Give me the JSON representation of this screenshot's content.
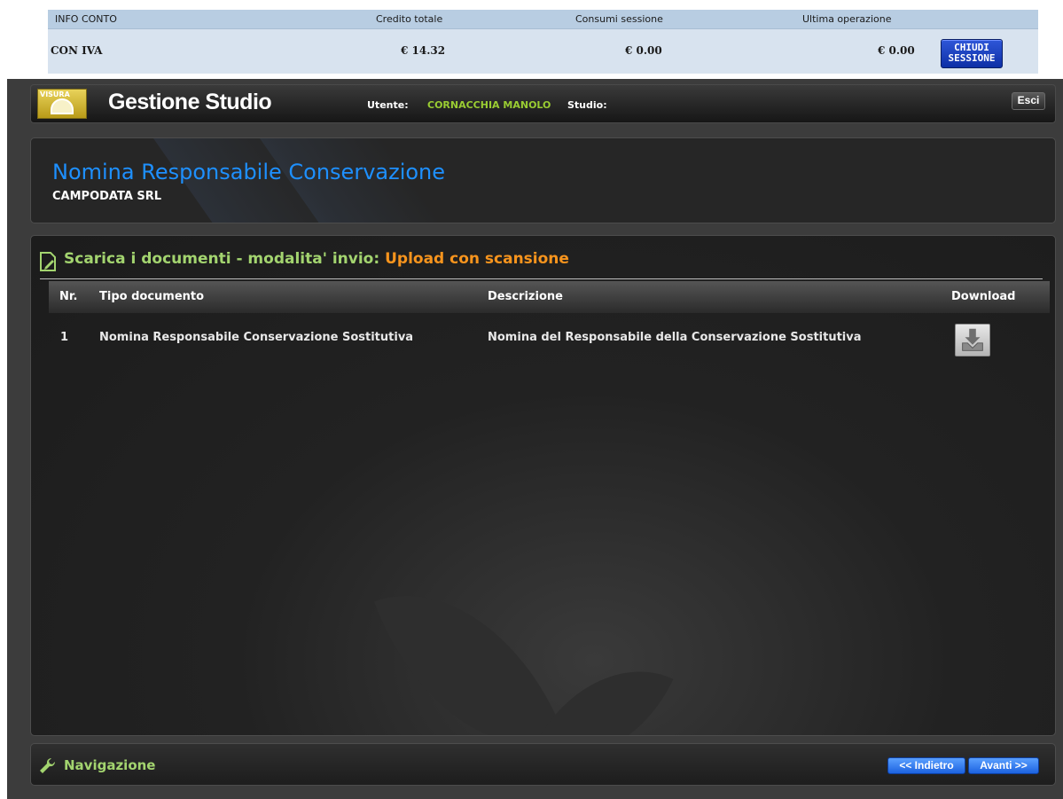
{
  "account": {
    "head": {
      "info": "INFO CONTO",
      "credit": "Credito totale",
      "session": "Consumi sessione",
      "last": "Ultima operazione"
    },
    "row": {
      "label": "CON IVA",
      "credit": "€ 14.32",
      "session": "€ 0.00",
      "last": "€ 0.00"
    },
    "close_button": {
      "line1": "CHIUDI",
      "line2": "SESSIONE"
    }
  },
  "header": {
    "logo_text": "VISURA",
    "app_title": "Gestione Studio",
    "user_label": "Utente:",
    "user_name": "CORNACCHIA MANOLO",
    "studio_label": "Studio:",
    "studio_value": "",
    "exit_label": "Esci"
  },
  "title_panel": {
    "title": "Nomina Responsabile Conservazione",
    "subtitle": "CAMPODATA SRL"
  },
  "documents": {
    "heading": "Scarica i documenti - modalita' invio:",
    "mode": "Upload con scansione",
    "columns": [
      "Nr.",
      "Tipo documento",
      "Descrizione",
      "Download"
    ],
    "rows": [
      {
        "nr": "1",
        "type": "Nomina Responsabile Conservazione Sostitutiva",
        "description": "Nomina del Responsabile della Conservazione Sostitutiva",
        "download_icon": "download-tray-icon"
      }
    ]
  },
  "navigation": {
    "label": "Navigazione",
    "back_label": "<< Indietro",
    "next_label": "Avanti >>",
    "icon": "wrench-icon"
  },
  "colors": {
    "accent_green": "#a3d46f",
    "accent_orange": "#f7941d",
    "title_blue": "#1e90ff",
    "button_blue": "#1c62e0"
  }
}
